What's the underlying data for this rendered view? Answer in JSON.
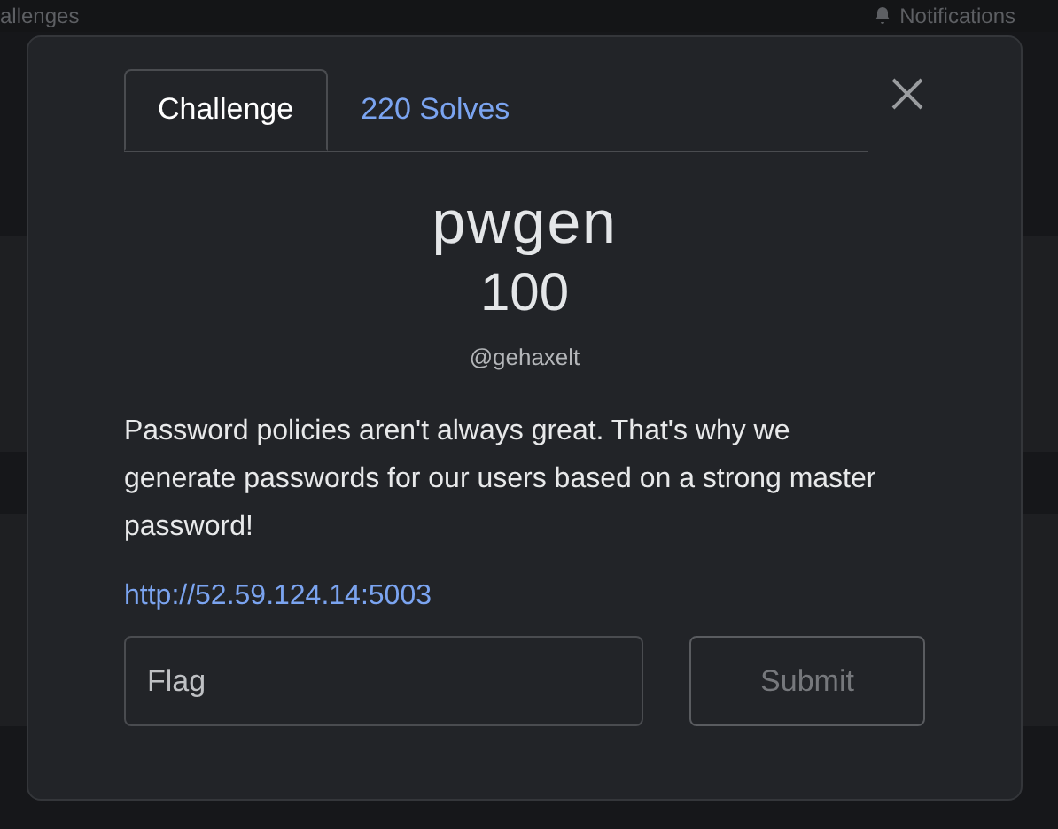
{
  "navbar": {
    "left_link": "allenges",
    "notifications": "Notifications"
  },
  "modal": {
    "tabs": [
      {
        "label": "Challenge",
        "selected": true
      },
      {
        "label": "220 Solves",
        "selected": false
      }
    ],
    "title": "pwgen",
    "points": "100",
    "author": "@gehaxelt",
    "description": "Password policies aren't always great. That's why we generate passwords for our users based on a strong master password!",
    "link": "http://52.59.124.14:5003",
    "flag_field": {
      "placeholder": "Flag"
    },
    "submit_button": {
      "label": "Submit",
      "disabled": true
    }
  }
}
